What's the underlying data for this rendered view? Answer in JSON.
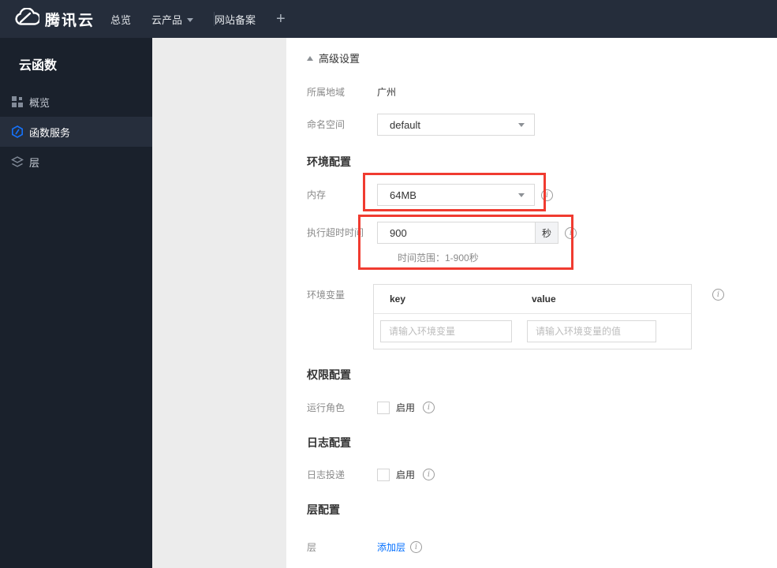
{
  "topbar": {
    "brand": "腾讯云",
    "nav_overview": "总览",
    "nav_products": "云产品",
    "nav_icp": "网站备案",
    "nav_plus": "+"
  },
  "sidebar": {
    "title": "云函数",
    "items": [
      {
        "label": "概览",
        "icon": "grid-icon",
        "active": false
      },
      {
        "label": "函数服务",
        "icon": "function-icon",
        "active": true
      },
      {
        "label": "层",
        "icon": "layers-icon",
        "active": false
      }
    ]
  },
  "content": {
    "advanced_settings_label": "高级设置",
    "region_label": "所属地域",
    "region_value": "广州",
    "namespace_label": "命名空间",
    "namespace_value": "default",
    "env_section_title": "环境配置",
    "memory_label": "内存",
    "memory_value": "64MB",
    "timeout_label": "执行超时时间",
    "timeout_value": "900",
    "timeout_unit": "秒",
    "timeout_hint": "时间范围：1-900秒",
    "envvars_label": "环境变量",
    "envvars_col_key": "key",
    "envvars_col_value": "value",
    "envvars_key_placeholder": "请输入环境变量",
    "envvars_value_placeholder": "请输入环境变量的值",
    "perm_section_title": "权限配置",
    "run_role_label": "运行角色",
    "run_role_checkbox": "启用",
    "log_section_title": "日志配置",
    "log_delivery_label": "日志投递",
    "log_delivery_checkbox": "启用",
    "layer_section_title": "层配置",
    "layer_label": "层",
    "layer_add_link": "添加层"
  },
  "colors": {
    "accent_blue": "#006eff",
    "highlight_red": "#f03b30",
    "topbar_bg": "#252d3b",
    "sidebar_bg": "#1a212c",
    "sidebar_active_bg": "#262e3c",
    "secondary_panel_bg": "#ececec"
  }
}
